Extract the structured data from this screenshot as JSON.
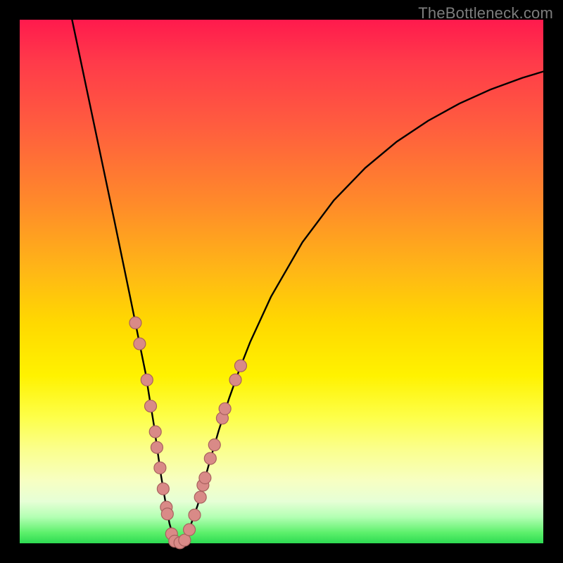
{
  "watermark": "TheBottleneck.com",
  "colors": {
    "background": "#000000",
    "curve": "#000000",
    "marker_fill": "#d98a87",
    "marker_stroke": "#a8615e"
  },
  "chart_data": {
    "type": "line",
    "title": "",
    "xlabel": "",
    "ylabel": "",
    "xlim": [
      0,
      100
    ],
    "ylim": [
      0,
      100
    ],
    "notes": "V-shaped bottleneck curve with rainbow gradient background; markers cluster near the trough",
    "series": [
      {
        "name": "curve",
        "x": [
          10,
          12,
          14,
          16,
          18,
          19.8,
          21,
          22,
          23,
          24,
          24.8,
          25.6,
          26.3,
          27,
          27.8,
          28.6,
          29.4,
          30.2,
          31,
          31.8,
          34,
          36,
          38,
          40,
          42,
          44,
          48,
          54,
          60,
          66,
          72,
          78,
          84,
          90,
          96,
          100
        ],
        "y": [
          100,
          90.5,
          81,
          71.5,
          62,
          53.3,
          47.5,
          42.6,
          37.6,
          32.7,
          27.7,
          22.8,
          17.8,
          12.9,
          8.1,
          3.8,
          1.0,
          0.1,
          0.1,
          1.0,
          7.3,
          14.6,
          21.5,
          27.7,
          33.3,
          38.4,
          47.1,
          57.5,
          65.5,
          71.7,
          76.7,
          80.7,
          84.0,
          86.7,
          88.9,
          90.1
        ]
      }
    ],
    "markers": [
      {
        "x": 22.1,
        "y": 42.1
      },
      {
        "x": 22.9,
        "y": 38.1
      },
      {
        "x": 24.3,
        "y": 31.2
      },
      {
        "x": 25.0,
        "y": 26.2
      },
      {
        "x": 25.9,
        "y": 21.3
      },
      {
        "x": 26.2,
        "y": 18.3
      },
      {
        "x": 26.8,
        "y": 14.4
      },
      {
        "x": 27.4,
        "y": 10.4
      },
      {
        "x": 28.0,
        "y": 6.9
      },
      {
        "x": 28.2,
        "y": 5.6
      },
      {
        "x": 29.0,
        "y": 1.8
      },
      {
        "x": 29.6,
        "y": 0.4
      },
      {
        "x": 30.6,
        "y": 0.1
      },
      {
        "x": 31.5,
        "y": 0.6
      },
      {
        "x": 32.4,
        "y": 2.6
      },
      {
        "x": 33.4,
        "y": 5.4
      },
      {
        "x": 34.5,
        "y": 8.8
      },
      {
        "x": 35.0,
        "y": 11.1
      },
      {
        "x": 35.4,
        "y": 12.5
      },
      {
        "x": 36.4,
        "y": 16.2
      },
      {
        "x": 37.2,
        "y": 18.8
      },
      {
        "x": 38.7,
        "y": 23.9
      },
      {
        "x": 39.2,
        "y": 25.7
      },
      {
        "x": 41.2,
        "y": 31.2
      },
      {
        "x": 42.2,
        "y": 33.9
      }
    ]
  }
}
